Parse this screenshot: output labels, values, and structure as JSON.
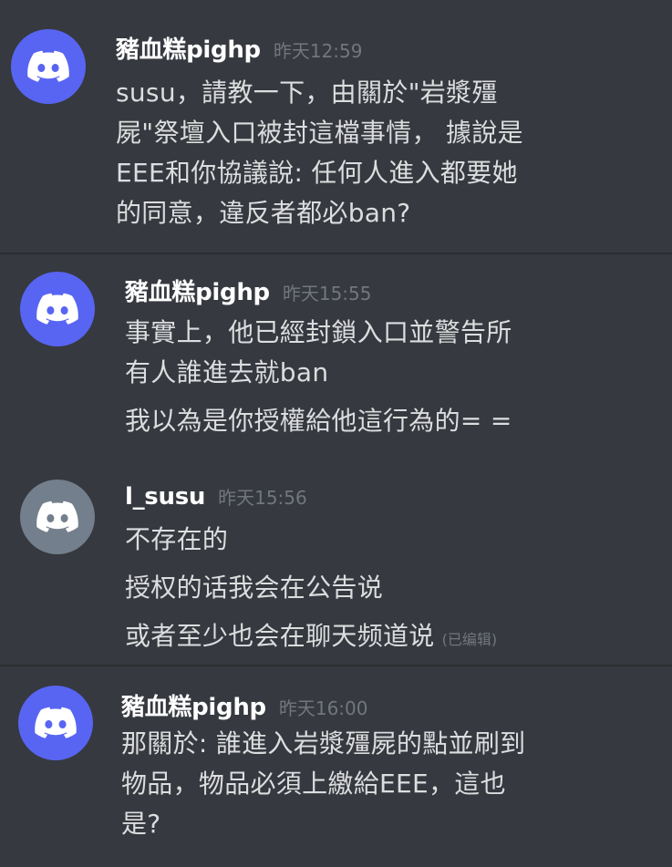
{
  "colors": {
    "background": "#36393f",
    "avatar_blurple": "#5865f2",
    "avatar_grey": "#747f8d",
    "username": "#ffffff",
    "timestamp": "#72767d",
    "message_text": "#dcddde"
  },
  "messages": [
    {
      "avatar_icon": "discord-logo-icon",
      "username": "豬血糕pighp",
      "timestamp": "昨天12:59",
      "lines": [
        "susu，請教一下，由關於\"岩漿殭",
        "屍\"祭壇入口被封這檔事情， 據說是",
        "EEE和你協議說: 任何人進入都要她",
        "的同意，違反者都必ban?"
      ]
    },
    {
      "avatar_icon": "discord-logo-icon",
      "username": "豬血糕pighp",
      "timestamp": "昨天15:55",
      "lines": [
        "事實上，他已經封鎖入口並警告所",
        "有人誰進去就ban",
        "我以為是你授權給他這行為的= ="
      ]
    },
    {
      "avatar_icon": "discord-logo-icon",
      "username": "l_susu",
      "timestamp": "昨天15:56",
      "lines": [
        "不存在的",
        "授权的话我会在公告说",
        "或者至少也会在聊天频道说"
      ],
      "edited_label": "(已编辑)"
    },
    {
      "avatar_icon": "discord-logo-icon",
      "username": "豬血糕pighp",
      "timestamp": "昨天16:00",
      "lines": [
        "那關於: 誰進入岩漿殭屍的點並刷到",
        "物品，物品必須上繳給EEE，這也",
        "是?"
      ]
    }
  ]
}
